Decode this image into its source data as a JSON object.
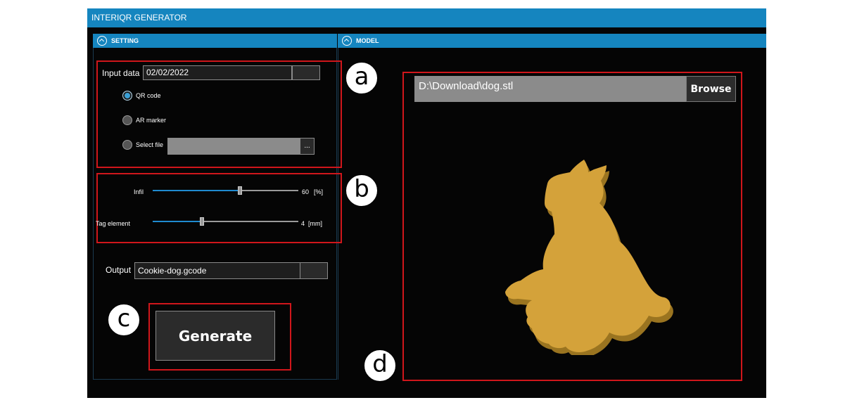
{
  "window": {
    "title": "INTERIQR GENERATOR"
  },
  "panels": {
    "setting": "SETTING",
    "model": "MODEL"
  },
  "input": {
    "label": "Input data",
    "value": "02/02/2022",
    "options": [
      {
        "label": "QR code",
        "selected": true
      },
      {
        "label": "AR marker",
        "selected": false
      },
      {
        "label": "Select file",
        "selected": false
      }
    ],
    "file_value": "",
    "browse_glyph": "..."
  },
  "sliders": {
    "infill": {
      "label": "Infil",
      "value": "60",
      "unit": "[%]",
      "fraction": 0.6
    },
    "tag": {
      "label": "Tag element",
      "value": "4",
      "unit": "[mm]",
      "fraction": 0.34
    }
  },
  "output": {
    "label": "Output",
    "value": "Cookie-dog.gcode"
  },
  "generate": {
    "label": "Generate"
  },
  "model": {
    "path": "D:\\Download\\dog.stl",
    "browse_label": "Browse",
    "model_color": "#d4a23a"
  },
  "callouts": {
    "a": "a",
    "b": "b",
    "c": "c",
    "d": "d"
  },
  "colors": {
    "accent": "#1585bf",
    "highlight": "#d0161b"
  }
}
